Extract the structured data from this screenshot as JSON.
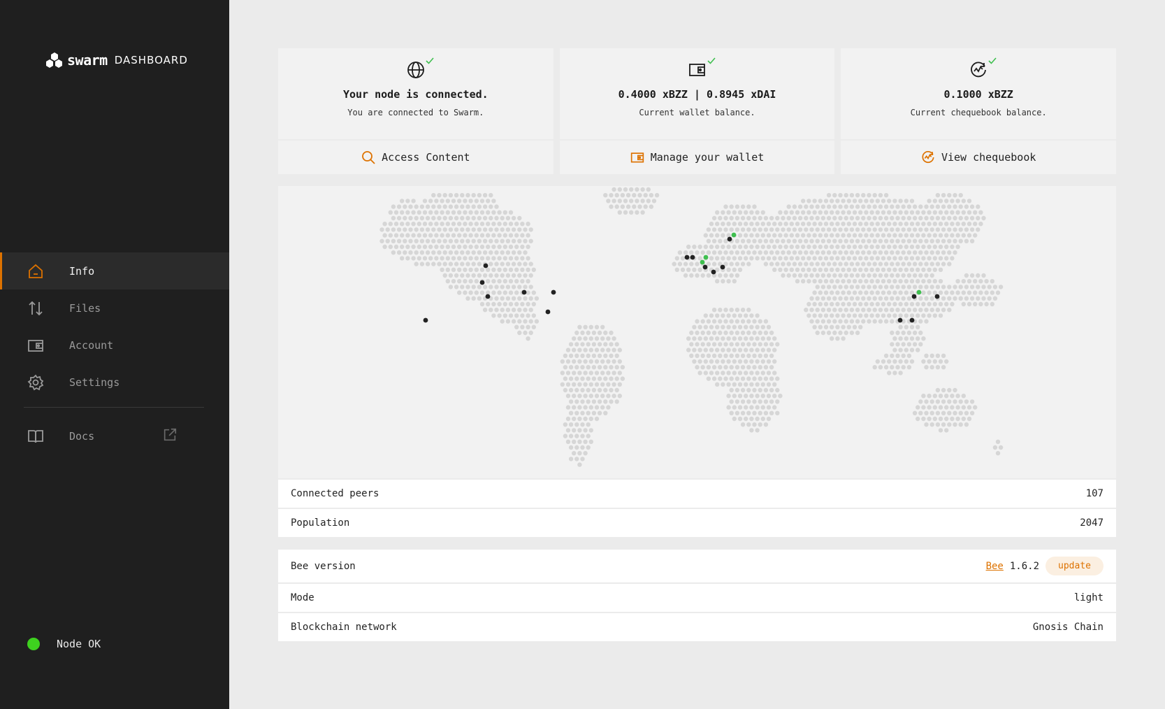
{
  "sidebar": {
    "logo_brand": "swarm",
    "logo_suffix": "DASHBOARD",
    "items": [
      {
        "label": "Info",
        "icon": "home-icon",
        "active": true
      },
      {
        "label": "Files",
        "icon": "transfer-arrows-icon"
      },
      {
        "label": "Account",
        "icon": "wallet-icon"
      },
      {
        "label": "Settings",
        "icon": "gear-icon"
      },
      {
        "label": "Docs",
        "icon": "book-icon",
        "external": true
      }
    ],
    "status_label": "Node OK",
    "status_color": "#3ed11f"
  },
  "cards": [
    {
      "title": "Your node is connected.",
      "subtitle": "You are connected to Swarm.",
      "button": "Access Content",
      "icon": "globe-icon",
      "button_icon": "search-icon"
    },
    {
      "title": "0.4000 xBZZ | 0.8945 xDAI",
      "subtitle": "Current wallet balance.",
      "button": "Manage your wallet",
      "icon": "wallet-icon",
      "button_icon": "wallet-icon"
    },
    {
      "title": "0.1000 xBZZ",
      "subtitle": "Current chequebook balance.",
      "button": "View chequebook",
      "icon": "chequebook-icon",
      "button_icon": "chequebook-icon"
    }
  ],
  "network": {
    "connected_peers_label": "Connected peers",
    "connected_peers": "107",
    "population_label": "Population",
    "population": "2047"
  },
  "node": {
    "bee_version_label": "Bee version",
    "bee_link": "Bee",
    "bee_version": "1.6.2",
    "update_label": "update",
    "mode_label": "Mode",
    "mode": "light",
    "blockchain_label": "Blockchain network",
    "blockchain": "Gnosis Chain"
  },
  "colors": {
    "accent": "#dd7200",
    "sidebar_bg": "#1f1f1f",
    "ok_green": "#3ed11f",
    "peer_dark": "#222222",
    "peer_green": "#3fbf4f"
  }
}
